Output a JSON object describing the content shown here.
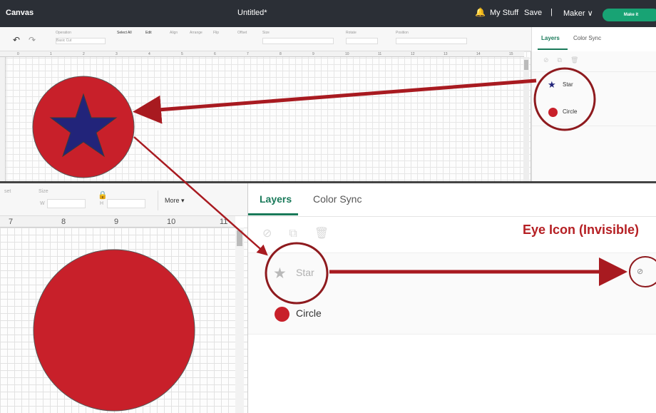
{
  "topbar": {
    "app_name": "Canvas",
    "doc_title": "Untitled*",
    "my_stuff": "My Stuff",
    "save": "Save",
    "separator": "|",
    "machine": "Maker ∨",
    "make_it": "Make it"
  },
  "toolbar_top": {
    "undo": "↶",
    "redo": "↷",
    "items": [
      "Operation",
      "Select All",
      "Edit",
      "Align",
      "Arrange",
      "Flip",
      "Offset",
      "Size",
      "Rotate",
      "Position"
    ],
    "operation_value": "Basic Cut"
  },
  "layers_panel_top": {
    "tab_layers": "Layers",
    "tab_color_sync": "Color Sync",
    "layer_star": "Star",
    "layer_circle": "Circle"
  },
  "ruler_top": [
    "0",
    "1",
    "2",
    "3",
    "4",
    "5",
    "6",
    "7",
    "8",
    "9",
    "10",
    "11",
    "12",
    "13",
    "14",
    "15"
  ],
  "toolbar_bottom": {
    "offset_label": "set",
    "size_label": "Size",
    "w_label": "W",
    "h_label": "H",
    "more": "More ▾"
  },
  "ruler_bottom": [
    "7",
    "8",
    "9",
    "10",
    "11"
  ],
  "layers_panel_bottom": {
    "tab_layers": "Layers",
    "tab_color_sync": "Color Sync",
    "layer_star": "Star",
    "layer_circle": "Circle"
  },
  "annotation": {
    "eye_icon_label": "Eye Icon (Invisible)"
  },
  "colors": {
    "circle_red": "#c8202a",
    "star_navy": "#22247a",
    "accent_green": "#1a7a5a",
    "annotation_red": "#a81a20"
  },
  "icons": {
    "bell": "bell-icon",
    "eye_hidden": "eye-slash-icon",
    "star": "star-icon"
  }
}
